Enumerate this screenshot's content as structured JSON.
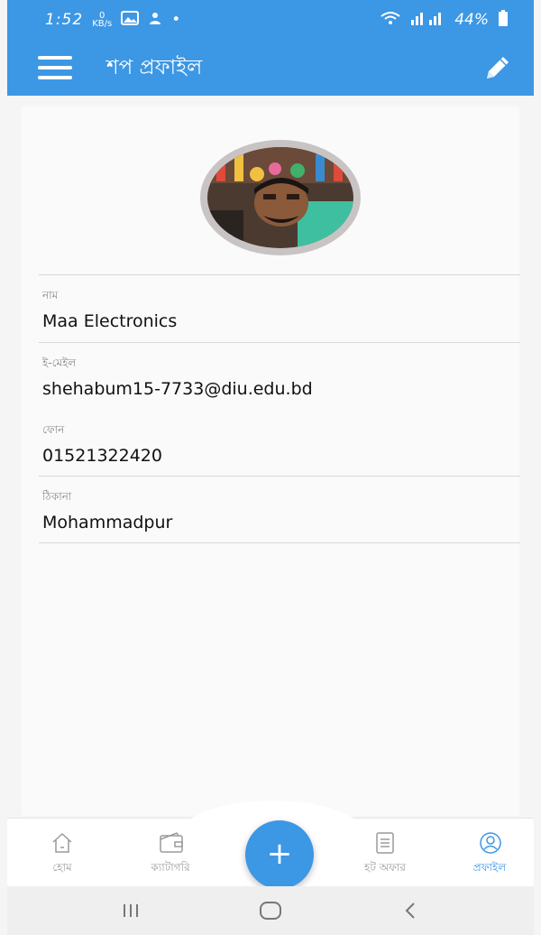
{
  "status_bar": {
    "time": "1:52",
    "data_speed_top": "0",
    "data_speed_bottom": "KB/s",
    "dot": "•",
    "battery_percent": "44%"
  },
  "app_bar": {
    "title": "শপ প্রফাইল",
    "menu_icon": "hamburger-menu-icon",
    "edit_icon": "pencil-icon"
  },
  "profile": {
    "avatar_alt": "profile-photo",
    "fields": [
      {
        "label": "নাম",
        "value": "Maa Electronics"
      },
      {
        "label": "ই-মেইল",
        "value": "shehabum15-7733@diu.edu.bd"
      },
      {
        "label": "ফোন",
        "value": "01521322420"
      },
      {
        "label": "ঠিকানা",
        "value": "Mohammadpur"
      }
    ]
  },
  "bottom_nav": {
    "items": [
      {
        "label": "হোম",
        "icon": "home-icon"
      },
      {
        "label": "ক্যাটাগরি",
        "icon": "wallet-icon"
      },
      {
        "label": "হট অফার",
        "icon": "list-icon"
      },
      {
        "label": "প্রফাইল",
        "icon": "profile-icon"
      }
    ],
    "fab_label": "+",
    "active_index": 3
  },
  "colors": {
    "primary": "#3c97e5",
    "label_gray": "#8a8a8a",
    "divider": "#d9d9d9"
  }
}
